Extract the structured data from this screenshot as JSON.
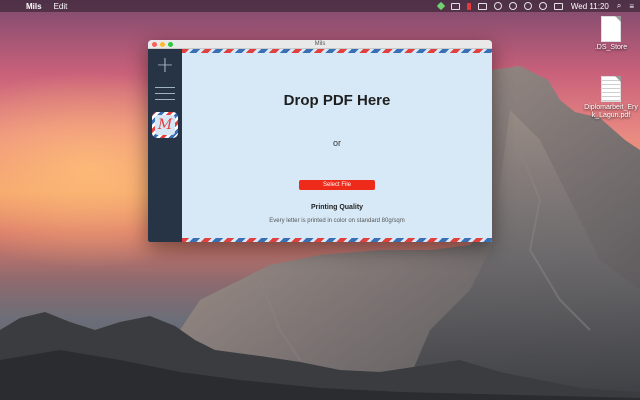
{
  "menubar": {
    "app_name": "Mils",
    "menus": [
      "Edit"
    ],
    "clock": "Wed 11:20"
  },
  "desktop": {
    "icons": [
      {
        "name": "file-icon",
        "label": ".DS_Store"
      },
      {
        "name": "pdf-file-icon",
        "label": "Diplomarbeit_Eryk_Lagun.pdf"
      }
    ]
  },
  "window": {
    "title": "Mils",
    "logo_letter": "M",
    "drop_title": "Drop PDF Here",
    "or_text": "or",
    "select_button": "Select File",
    "quality_title": "Printing Quality",
    "quality_desc": "Every letter is printed in color on standard 80g/sqm"
  },
  "colors": {
    "accent_red": "#ee2b1b",
    "sidebar_bg": "#263445",
    "content_bg": "#d7e9f7",
    "airmail_red": "#e2403f",
    "airmail_blue": "#3a6fb6"
  }
}
